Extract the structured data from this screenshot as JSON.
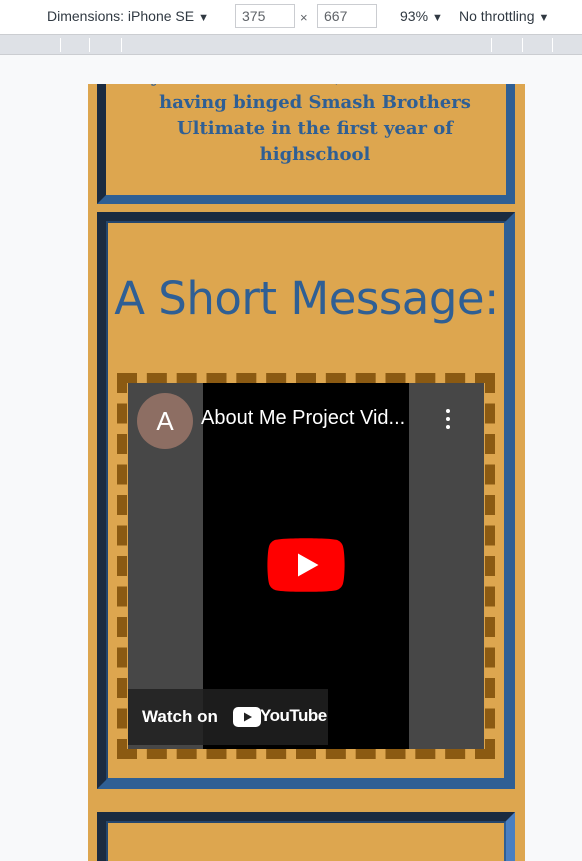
{
  "toolbar": {
    "device_label": "Dimensions: iPhone SE",
    "width_value": "375",
    "times": "×",
    "height_value": "667",
    "zoom": "93%",
    "throttling": "No throttling",
    "caret": "▼"
  },
  "page": {
    "caption": "My Nintendo Switch, well worn after having binged Smash Brothers Ultimate in the first year of highschool",
    "section_heading": "A Short Message:",
    "video": {
      "channel_initial": "A",
      "title": "About Me Project Vid...",
      "watch_on": "Watch on",
      "youtube_word": "YouTube"
    }
  },
  "colors": {
    "page_background": "#dda64f",
    "heading": "#2f5f94",
    "frame_dark": "#1b2b40",
    "frame_light": "#2f5f94",
    "dashed_border": "#8b5a12",
    "youtube_red": "#ff0000"
  },
  "icons": [
    "chevron-down-icon",
    "more-options-icon",
    "play-icon",
    "youtube-logo-icon"
  ]
}
